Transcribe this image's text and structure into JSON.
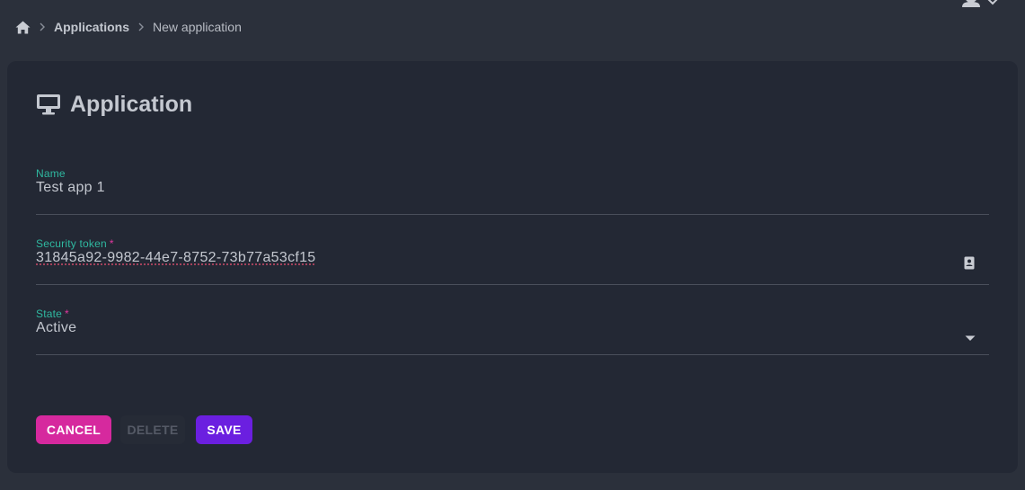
{
  "breadcrumb": {
    "home_icon": "home-icon",
    "items": [
      "Applications",
      "New application"
    ]
  },
  "header": {
    "user_icon": "user-icon"
  },
  "card": {
    "title": "Application",
    "title_icon": "monitor-icon"
  },
  "form": {
    "name": {
      "label": "Name",
      "value": "Test app 1"
    },
    "security_token": {
      "label": "Security token",
      "required_mark": "*",
      "value": "31845a92-9982-44e7-8752-73b77a53cf15",
      "icon": "contact-card-icon"
    },
    "state": {
      "label": "State",
      "required_mark": "*",
      "value": "Active",
      "icon": "caret-down-icon"
    }
  },
  "actions": {
    "cancel_label": "CANCEL",
    "delete_label": "DELETE",
    "save_label": "SAVE"
  },
  "colors": {
    "page_bg": "#2b303b",
    "card_bg": "#232834",
    "label_teal": "#2fb8a0",
    "required_pink": "#e0389f",
    "cancel_bg": "#d6299e",
    "save_bg": "#6b1fe0"
  }
}
